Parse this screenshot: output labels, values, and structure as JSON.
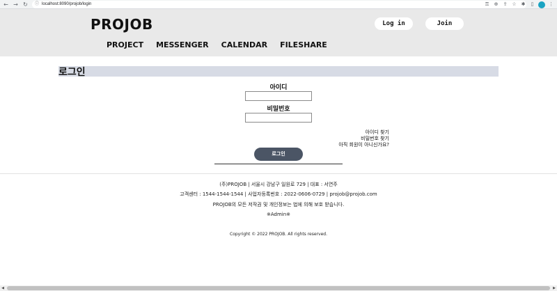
{
  "browser": {
    "url": "localhost:8090/projob/login",
    "back_glyph": "←",
    "forward_glyph": "→",
    "reload_glyph": "↻",
    "lock_glyph": "ⓘ",
    "icons": [
      "key-icon",
      "zoom-icon",
      "share-icon",
      "star-icon",
      "extensions-icon",
      "sidepanel-icon"
    ],
    "icon_glyphs": [
      "⚿",
      "⊕",
      "⇪",
      "☆",
      "✱",
      "▯"
    ],
    "menu_glyph": "⋮"
  },
  "header": {
    "logo": "PROJOB",
    "login_label": "Log in",
    "join_label": "Join",
    "nav": [
      "PROJECT",
      "MESSENGER",
      "CALENDAR",
      "FILESHARE"
    ]
  },
  "login": {
    "title": "로그인",
    "id_label": "아이디",
    "id_value": "",
    "password_label": "비밀번호",
    "password_value": "",
    "find_id": "아이디 찾기",
    "find_password": "비밀번호 찾기",
    "not_member": "아직 회원이 아니신가요?",
    "submit_label": "로그인"
  },
  "footer": {
    "line1": "(주)PROJOB | 서울시 강남구 일원로 729 | 대표 : 서연주",
    "line2": "고객센터 : 1544-1544-1544 | 사업자등록번호 : 2022-0606-0729 | projob@projob.com",
    "line3": "PROJOB의 모든 저작권 및 개인정보는 법에 의해 보호 받습니다.",
    "admin": "※Admin※",
    "copyright": "Copyright © 2022 PROJOB. All rights reserved."
  },
  "scrollbar": {
    "left_glyph": "◀",
    "right_glyph": "▶"
  }
}
